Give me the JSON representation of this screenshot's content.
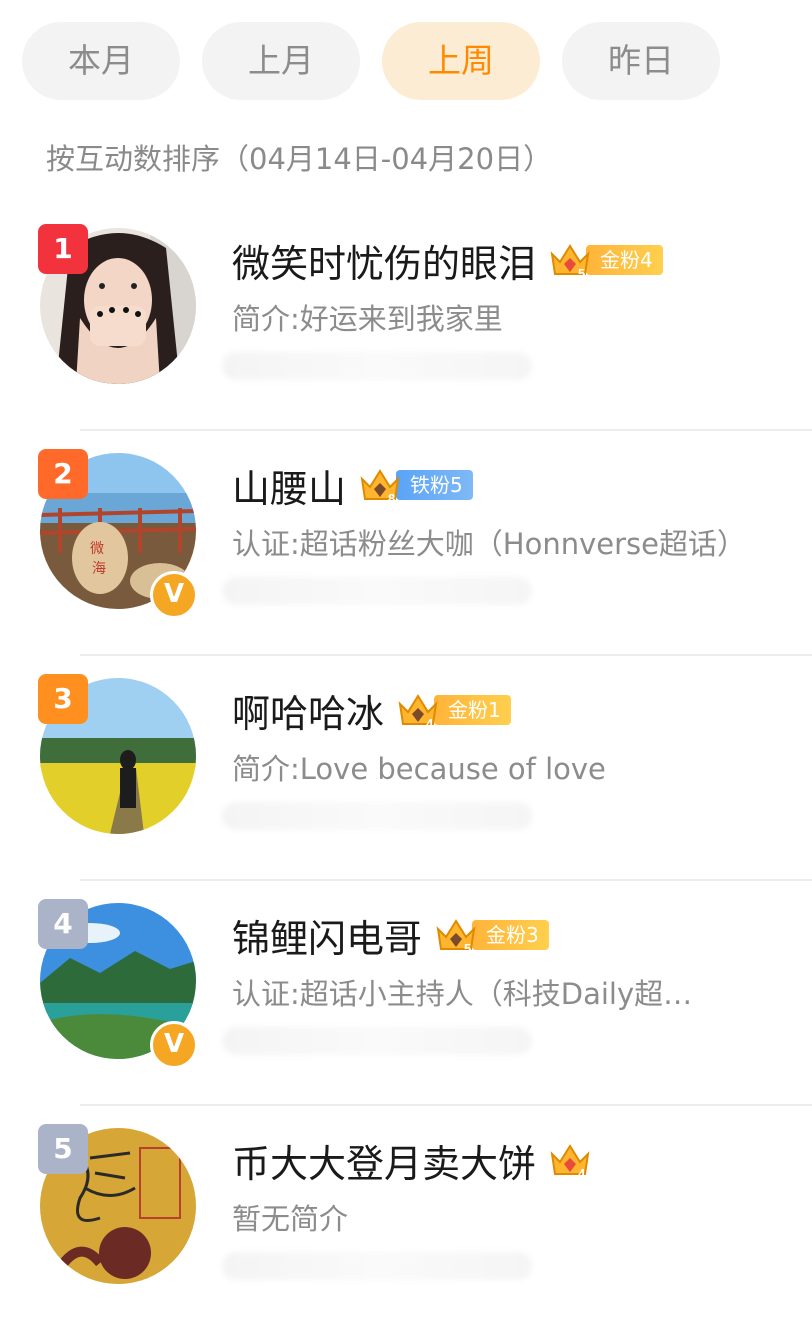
{
  "tabs": [
    {
      "label": "本月",
      "active": false
    },
    {
      "label": "上月",
      "active": false
    },
    {
      "label": "上周",
      "active": true
    },
    {
      "label": "昨日",
      "active": false
    }
  ],
  "subtitle": "按互动数排序（04月14日-04月20日）",
  "colors": {
    "accent": "#ff8a00",
    "rank1": "#f2333d",
    "rank2": "#ff6a2a",
    "rank3": "#ff8f1f",
    "rank_other": "#aab3c7",
    "gold_badge": "#ffb43a",
    "iron_badge": "#5aa4f5",
    "verified": "#f5a623"
  },
  "users": [
    {
      "rank": "1",
      "name": "微笑时忧伤的眼泪",
      "crown_level": "5",
      "badge": "金粉4",
      "badge_type": "gold",
      "desc": "简介:好运来到我家里",
      "verified": false,
      "avatar": "girl-portrait"
    },
    {
      "rank": "2",
      "name": "山腰山",
      "crown_level": "8",
      "badge": "铁粉5",
      "badge_type": "iron",
      "desc": "认证:超话粉丝大咖（Honnverse超话）",
      "verified": true,
      "avatar": "seaside-rocks"
    },
    {
      "rank": "3",
      "name": "啊哈哈冰",
      "crown_level": "4",
      "badge": "金粉1",
      "badge_type": "gold",
      "desc": "简介:Love because of love",
      "verified": false,
      "avatar": "flower-field"
    },
    {
      "rank": "4",
      "name": "锦鲤闪电哥",
      "crown_level": "5",
      "badge": "金粉3",
      "badge_type": "gold",
      "desc": "认证:超话小主持人（科技Daily超…",
      "verified": true,
      "avatar": "mountain-lake"
    },
    {
      "rank": "5",
      "name": "币大大登月卖大饼",
      "crown_level": "4",
      "badge": "",
      "badge_type": "",
      "desc": "暂无简介",
      "verified": false,
      "avatar": "calligraphy-paper"
    }
  ]
}
